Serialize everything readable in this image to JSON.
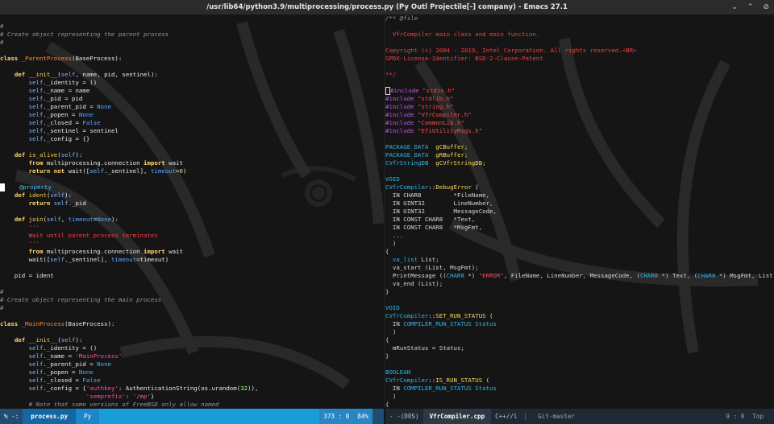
{
  "window": {
    "title": "/usr/lib64/python3.9/multiprocessing/process.py (Py Outl Projectile[-] company) - Emacs 27.1",
    "controls": [
      "⌄",
      "⌃",
      "⊘"
    ]
  },
  "left_pane": {
    "lines": [
      [
        [
          "",
          "c-name"
        ]
      ],
      [
        [
          "#",
          "c-comment"
        ]
      ],
      [
        [
          "# Create object representing the parent process",
          "c-comment"
        ]
      ],
      [
        [
          "#",
          "c-comment"
        ]
      ],
      [
        [
          "",
          "c-name"
        ]
      ],
      [
        [
          "class ",
          "c-kw"
        ],
        [
          "_ParentProcess",
          "c-cls"
        ],
        [
          "(BaseProcess):",
          "c-op"
        ]
      ],
      [
        [
          "",
          "c-name"
        ]
      ],
      [
        [
          "    ",
          "c-name"
        ],
        [
          "def ",
          "c-kw"
        ],
        [
          "__init__",
          "c-fn"
        ],
        [
          "(",
          "c-op"
        ],
        [
          "self",
          "c-self"
        ],
        [
          ", name, pid, sentinel):",
          "c-op"
        ]
      ],
      [
        [
          "        ",
          "c-name"
        ],
        [
          "self",
          "c-self"
        ],
        [
          "._identity = ()",
          "c-op"
        ]
      ],
      [
        [
          "        ",
          "c-name"
        ],
        [
          "self",
          "c-self"
        ],
        [
          "._name = name",
          "c-op"
        ]
      ],
      [
        [
          "        ",
          "c-name"
        ],
        [
          "self",
          "c-self"
        ],
        [
          "._pid = pid",
          "c-op"
        ]
      ],
      [
        [
          "        ",
          "c-name"
        ],
        [
          "self",
          "c-self"
        ],
        [
          "._parent_pid = ",
          "c-op"
        ],
        [
          "None",
          "c-blue"
        ]
      ],
      [
        [
          "        ",
          "c-name"
        ],
        [
          "self",
          "c-self"
        ],
        [
          "._popen = ",
          "c-op"
        ],
        [
          "None",
          "c-blue"
        ]
      ],
      [
        [
          "        ",
          "c-name"
        ],
        [
          "self",
          "c-self"
        ],
        [
          "._closed = ",
          "c-op"
        ],
        [
          "False",
          "c-blue"
        ]
      ],
      [
        [
          "        ",
          "c-name"
        ],
        [
          "self",
          "c-self"
        ],
        [
          "._sentinel = sentinel",
          "c-op"
        ]
      ],
      [
        [
          "        ",
          "c-name"
        ],
        [
          "self",
          "c-self"
        ],
        [
          "._config = {}",
          "c-op"
        ]
      ],
      [
        [
          "",
          "c-name"
        ]
      ],
      [
        [
          "    ",
          "c-name"
        ],
        [
          "def ",
          "c-kw"
        ],
        [
          "is_alive",
          "c-fn"
        ],
        [
          "(",
          "c-op"
        ],
        [
          "self",
          "c-self"
        ],
        [
          "):",
          "c-op"
        ]
      ],
      [
        [
          "        ",
          "c-name"
        ],
        [
          "from ",
          "c-kw"
        ],
        [
          "multiprocessing.connection ",
          "c-op"
        ],
        [
          "import ",
          "c-kw"
        ],
        [
          "wait",
          "c-op"
        ]
      ],
      [
        [
          "        ",
          "c-name"
        ],
        [
          "return not ",
          "c-kw"
        ],
        [
          "wait([",
          "c-op"
        ],
        [
          "self",
          "c-self"
        ],
        [
          "._sentinel], ",
          "c-op"
        ],
        [
          "timeout",
          "c-blue"
        ],
        [
          "=",
          "c-op"
        ],
        [
          "0",
          "c-num"
        ],
        [
          ")",
          "c-op"
        ]
      ],
      [
        [
          "",
          "c-name"
        ]
      ],
      [
        [
          "    ",
          "c-name"
        ],
        [
          "@property",
          "c-deco"
        ]
      ],
      [
        [
          "    ",
          "c-name"
        ],
        [
          "def ",
          "c-kw"
        ],
        [
          "ident",
          "c-fn"
        ],
        [
          "(",
          "c-op"
        ],
        [
          "self",
          "c-self"
        ],
        [
          "):",
          "c-op"
        ]
      ],
      [
        [
          "        ",
          "c-name"
        ],
        [
          "return ",
          "c-kw"
        ],
        [
          "self",
          "c-self"
        ],
        [
          "._pid",
          "c-op"
        ]
      ],
      [
        [
          "",
          "c-name"
        ]
      ],
      [
        [
          "    ",
          "c-name"
        ],
        [
          "def ",
          "c-kw"
        ],
        [
          "join",
          "c-fn"
        ],
        [
          "(",
          "c-op"
        ],
        [
          "self",
          "c-self"
        ],
        [
          ", ",
          "c-op"
        ],
        [
          "timeout",
          "c-blue"
        ],
        [
          "=",
          "c-op"
        ],
        [
          "None",
          "c-blue"
        ],
        [
          "):",
          "c-op"
        ]
      ],
      [
        [
          "        '''",
          "c-red"
        ]
      ],
      [
        [
          "        Wait until parent process terminates",
          "c-red"
        ]
      ],
      [
        [
          "        '''",
          "c-red"
        ]
      ],
      [
        [
          "        ",
          "c-name"
        ],
        [
          "from ",
          "c-kw"
        ],
        [
          "multiprocessing.connection ",
          "c-op"
        ],
        [
          "import ",
          "c-kw"
        ],
        [
          "wait",
          "c-op"
        ]
      ],
      [
        [
          "        wait([",
          "c-op"
        ],
        [
          "self",
          "c-self"
        ],
        [
          "._sentinel], ",
          "c-op"
        ],
        [
          "timeout",
          "c-blue"
        ],
        [
          "=timeout)",
          "c-op"
        ]
      ],
      [
        [
          "",
          "c-name"
        ]
      ],
      [
        [
          "    pid = ident",
          "c-op"
        ]
      ],
      [
        [
          "",
          "c-name"
        ]
      ],
      [
        [
          "#",
          "c-comment"
        ]
      ],
      [
        [
          "# Create object representing the main process",
          "c-comment"
        ]
      ],
      [
        [
          "#",
          "c-comment"
        ]
      ],
      [
        [
          "",
          "c-name"
        ]
      ],
      [
        [
          "class ",
          "c-kw"
        ],
        [
          "_MainProcess",
          "c-cls"
        ],
        [
          "(BaseProcess):",
          "c-op"
        ]
      ],
      [
        [
          "",
          "c-name"
        ]
      ],
      [
        [
          "    ",
          "c-name"
        ],
        [
          "def ",
          "c-kw"
        ],
        [
          "__init__",
          "c-fn"
        ],
        [
          "(",
          "c-op"
        ],
        [
          "self",
          "c-self"
        ],
        [
          "):",
          "c-op"
        ]
      ],
      [
        [
          "        ",
          "c-name"
        ],
        [
          "self",
          "c-self"
        ],
        [
          "._identity = ()",
          "c-op"
        ]
      ],
      [
        [
          "        ",
          "c-name"
        ],
        [
          "self",
          "c-self"
        ],
        [
          "._name = ",
          "c-op"
        ],
        [
          "'MainProcess'",
          "c-str"
        ]
      ],
      [
        [
          "        ",
          "c-name"
        ],
        [
          "self",
          "c-self"
        ],
        [
          "._parent_pid = ",
          "c-op"
        ],
        [
          "None",
          "c-blue"
        ]
      ],
      [
        [
          "        ",
          "c-name"
        ],
        [
          "self",
          "c-self"
        ],
        [
          "._popen = ",
          "c-op"
        ],
        [
          "None",
          "c-blue"
        ]
      ],
      [
        [
          "        ",
          "c-name"
        ],
        [
          "self",
          "c-self"
        ],
        [
          "._closed = ",
          "c-op"
        ],
        [
          "False",
          "c-blue"
        ]
      ],
      [
        [
          "        ",
          "c-name"
        ],
        [
          "self",
          "c-self"
        ],
        [
          "._config = {",
          "c-op"
        ],
        [
          "'authkey'",
          "c-str"
        ],
        [
          ": AuthenticationString(os.urandom(",
          "c-op"
        ],
        [
          "32",
          "c-num"
        ],
        [
          ")),",
          "c-op"
        ]
      ],
      [
        [
          "                        ",
          "c-name"
        ],
        [
          "'semprefix'",
          "c-str"
        ],
        [
          ": ",
          "c-op"
        ],
        [
          "'/mp'",
          "c-str"
        ],
        [
          "}",
          "c-op"
        ]
      ],
      [
        [
          "        # Note that some versions of FreeBSD only allow named",
          "c-comment"
        ]
      ]
    ],
    "cursor_line": 21
  },
  "right_pane": {
    "lines": [
      [
        [
          "/** @file",
          "c-comment"
        ]
      ],
      [
        [
          "",
          "c-name"
        ]
      ],
      [
        [
          "  VfrCompiler main class and main function.",
          "c-red"
        ]
      ],
      [
        [
          "",
          "c-name"
        ]
      ],
      [
        [
          "Copyright (c) 2004 - 2019, Intel Corporation. All rights reserved.<BR>",
          "c-red"
        ]
      ],
      [
        [
          "SPDX-License-Identifier: BSD-2-Clause-Patent",
          "c-red"
        ]
      ],
      [
        [
          "",
          "c-name"
        ]
      ],
      [
        [
          "**/",
          "c-red"
        ]
      ],
      [
        [
          "",
          "c-name"
        ]
      ],
      [
        [
          "#include ",
          "c-inc"
        ],
        [
          "\"stdio.h\"",
          "c-incstr"
        ]
      ],
      [
        [
          "#include ",
          "c-inc"
        ],
        [
          "\"stdlib.h\"",
          "c-incstr"
        ]
      ],
      [
        [
          "#include ",
          "c-inc"
        ],
        [
          "\"string.h\"",
          "c-incstr"
        ]
      ],
      [
        [
          "#include ",
          "c-inc"
        ],
        [
          "\"VfrCompiler.h\"",
          "c-incstr"
        ]
      ],
      [
        [
          "#include ",
          "c-inc"
        ],
        [
          "\"CommonLib.h\"",
          "c-incstr"
        ]
      ],
      [
        [
          "#include ",
          "c-inc"
        ],
        [
          "\"EfiUtilityMsgs.h\"",
          "c-incstr"
        ]
      ],
      [
        [
          "",
          "c-name"
        ]
      ],
      [
        [
          "PACKAGE_DATA  ",
          "c-type"
        ],
        [
          "gCBuffer;",
          "c-val"
        ]
      ],
      [
        [
          "PACKAGE_DATA  ",
          "c-type"
        ],
        [
          "gRBuffer;",
          "c-val"
        ]
      ],
      [
        [
          "CVfrStringDB  ",
          "c-type"
        ],
        [
          "gCVfrStringDB;",
          "c-val"
        ]
      ],
      [
        [
          "",
          "c-name"
        ]
      ],
      [
        [
          "VOID",
          "c-type"
        ]
      ],
      [
        [
          "CVfrCompiler",
          "c-type"
        ],
        [
          "::",
          "c-op"
        ],
        [
          "DebugError",
          "c-val"
        ],
        [
          " (",
          "c-op"
        ]
      ],
      [
        [
          "  IN CHAR8         *FileName,",
          "c-dflt"
        ]
      ],
      [
        [
          "  IN UINT32        LineNumber,",
          "c-dflt"
        ]
      ],
      [
        [
          "  IN UINT32        MessageCode,",
          "c-dflt"
        ]
      ],
      [
        [
          "  IN CONST CHAR8   *Text,",
          "c-dflt"
        ]
      ],
      [
        [
          "  IN CONST CHAR8   *MsgFmt,",
          "c-dflt"
        ]
      ],
      [
        [
          "  ...",
          "c-dflt"
        ]
      ],
      [
        [
          "  )",
          "c-dflt"
        ]
      ],
      [
        [
          "{",
          "c-dflt"
        ]
      ],
      [
        [
          "  va_list ",
          "c-type"
        ],
        [
          "List;",
          "c-dflt"
        ]
      ],
      [
        [
          "  va_start (List, MsgFmt);",
          "c-dflt"
        ]
      ],
      [
        [
          "  PrintMessage ((",
          "c-dflt"
        ],
        [
          "CHAR8",
          "c-type"
        ],
        [
          " *) ",
          "c-dflt"
        ],
        [
          "\"ERROR\"",
          "c-incstr"
        ],
        [
          ", FileName, LineNumber, MessageCode, (",
          "c-dflt"
        ],
        [
          "CHAR8",
          "c-type"
        ],
        [
          " *) Text, (",
          "c-dflt"
        ],
        [
          "CHAR8",
          "c-type"
        ],
        [
          " *) MsgFmt, List",
          "c-dflt"
        ]
      ],
      [
        [
          "  va_end (List);",
          "c-dflt"
        ]
      ],
      [
        [
          "}",
          "c-dflt"
        ]
      ],
      [
        [
          "",
          "c-name"
        ]
      ],
      [
        [
          "VOID",
          "c-type"
        ]
      ],
      [
        [
          "CVfrCompiler",
          "c-type"
        ],
        [
          "::",
          "c-op"
        ],
        [
          "SET_RUN_STATUS",
          "c-val"
        ],
        [
          " (",
          "c-op"
        ]
      ],
      [
        [
          "  IN ",
          "c-dflt"
        ],
        [
          "COMPILER_RUN_STATUS Status",
          "c-type"
        ]
      ],
      [
        [
          "  )",
          "c-dflt"
        ]
      ],
      [
        [
          "{",
          "c-dflt"
        ]
      ],
      [
        [
          "  mRunStatus = Status;",
          "c-dflt"
        ]
      ],
      [
        [
          "}",
          "c-dflt"
        ]
      ],
      [
        [
          "",
          "c-name"
        ]
      ],
      [
        [
          "BOOLEAN",
          "c-type"
        ]
      ],
      [
        [
          "CVfrCompiler",
          "c-type"
        ],
        [
          "::",
          "c-op"
        ],
        [
          "IS_RUN_STATUS",
          "c-val"
        ],
        [
          " (",
          "c-op"
        ]
      ],
      [
        [
          "  IN ",
          "c-dflt"
        ],
        [
          "COMPILER_RUN_STATUS Status",
          "c-type"
        ]
      ],
      [
        [
          "  )",
          "c-dflt"
        ]
      ],
      [
        [
          "{",
          "c-dflt"
        ]
      ]
    ],
    "cursor_line": 9
  },
  "modeline_left": {
    "state": "% -:",
    "file": "process.py",
    "mode": "Py",
    "position": "373 : 0",
    "percent": "84%"
  },
  "modeline_right": {
    "state": "- -(DOS)",
    "file": "VfrCompiler.cpp",
    "mode": "C++//l",
    "branch": "Git-master",
    "position": "9 : 0",
    "percent": "Top"
  }
}
